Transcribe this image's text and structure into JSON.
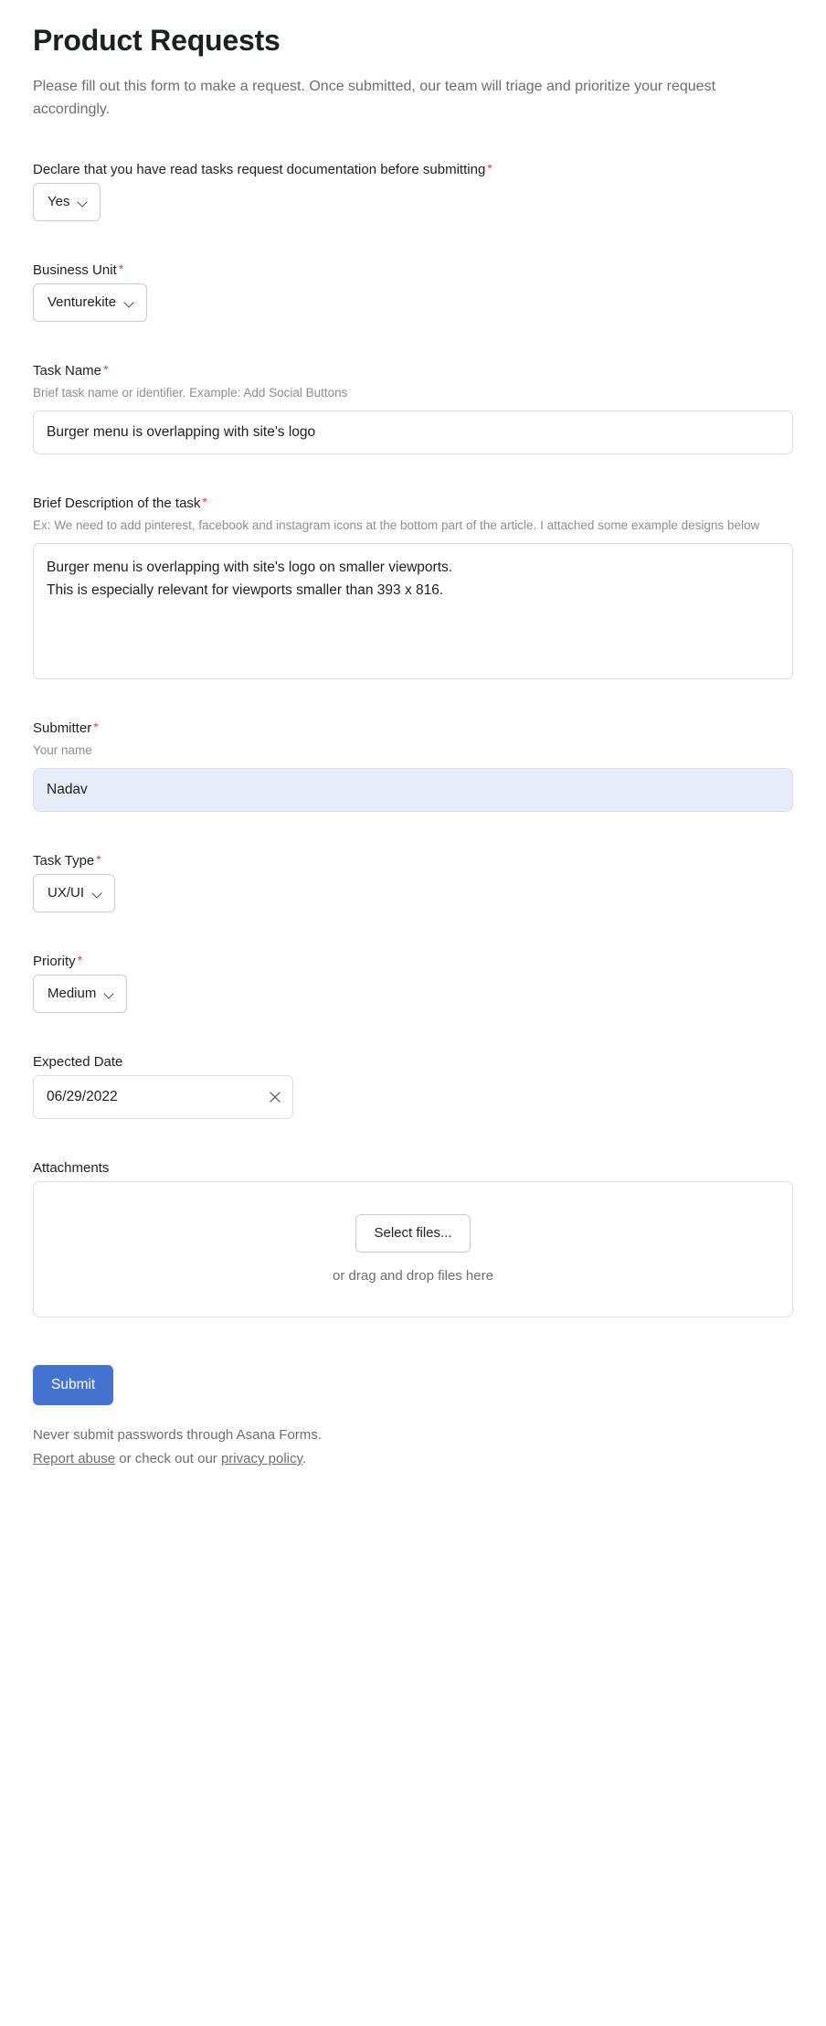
{
  "form": {
    "title": "Product Requests",
    "subtitle": "Please fill out this form to make a request. Once submitted, our team will triage and prioritize your request accordingly."
  },
  "fields": {
    "declare": {
      "label": "Declare that you have read tasks request documentation before submitting",
      "required_marker": "*",
      "value": "Yes"
    },
    "business_unit": {
      "label": "Business Unit",
      "required_marker": "*",
      "value": "Venturekite"
    },
    "task_name": {
      "label": "Task Name",
      "required_marker": "*",
      "help": "Brief task name or identifier. Example: Add Social Buttons",
      "value": "Burger menu is overlapping with site's logo",
      "placeholder": ""
    },
    "description": {
      "label": "Brief Description of the task",
      "required_marker": "*",
      "help": "Ex: We need to add pinterest, facebook and instagram icons at the bottom part of the article. I attached some example designs below",
      "value": "Burger menu is overlapping with site's logo on smaller viewports.\nThis is especially relevant for viewports smaller than 393 x 816.",
      "placeholder": ""
    },
    "submitter": {
      "label": "Submitter",
      "required_marker": "*",
      "help": "Your name",
      "value": "Nadav",
      "placeholder": "",
      "highlight_color": "#e7ecf9"
    },
    "task_type": {
      "label": "Task Type",
      "required_marker": "*",
      "value": "UX/UI"
    },
    "priority": {
      "label": "Priority",
      "required_marker": "*",
      "value": "Medium"
    },
    "expected_date": {
      "label": "Expected Date",
      "value": "06/29/2022",
      "placeholder": "",
      "clear_icon": "close-icon"
    },
    "attachments": {
      "label": "Attachments",
      "select_files_label": "Select files...",
      "drag_hint": "or drag and drop files here"
    }
  },
  "actions": {
    "submit_label": "Submit",
    "submit_color": "#4573d2"
  },
  "footer": {
    "warning": "Never submit passwords through Asana Forms.",
    "report_abuse": "Report abuse",
    "middle": " or check out our ",
    "privacy_policy": "privacy policy",
    "period": "."
  },
  "icons": {
    "chevron_down": "chevron-down-icon",
    "close": "close-icon"
  },
  "theme": {
    "required_asterisk_color": "#e8384f",
    "text_color": "#1e1f21",
    "muted_text_color": "#6d6e6f"
  }
}
